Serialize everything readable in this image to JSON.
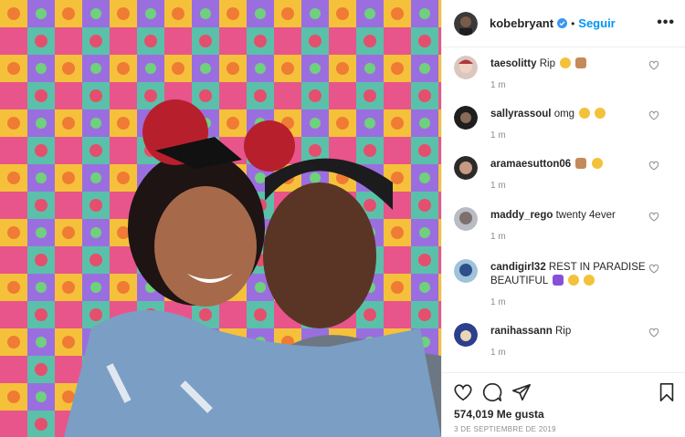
{
  "post": {
    "author": "kobebryant",
    "follow_label": "Seguir",
    "separator": "•",
    "more_label": "•••"
  },
  "comments": [
    {
      "username": "taesolitty",
      "text": "Rip",
      "emojis": [
        "disappointed-face",
        "folded-hands"
      ],
      "time": "1 m"
    },
    {
      "username": "sallyrassoul",
      "text": "omg",
      "emojis": [
        "crying-face",
        "crying-face"
      ],
      "time": "1 m"
    },
    {
      "username": "aramaesutton06",
      "text": "",
      "emojis": [
        "folded-hands",
        "crying-face"
      ],
      "time": "1 m"
    },
    {
      "username": "maddy_rego",
      "text": "twenty 4ever",
      "emojis": [],
      "time": "1 m"
    },
    {
      "username": "candigirl32",
      "text": "REST IN PARADISE BEAUTIFUL",
      "emojis": [
        "purple-heart",
        "disappointed-face",
        "disappointed-face"
      ],
      "time": "1 m"
    },
    {
      "username": "ranihassann",
      "text": "Rip",
      "emojis": [],
      "time": "1 m"
    }
  ],
  "actions": {
    "likes": "574,019 Me gusta",
    "date": "3 DE SEPTIEMBRE DE 2019"
  },
  "colors": {
    "accent": "#0095f6",
    "muted": "#8e8e8e",
    "border": "#efefef"
  },
  "icons": [
    "verified-badge-icon",
    "more-options-icon",
    "heart-icon",
    "comment-icon",
    "share-icon",
    "bookmark-icon"
  ]
}
